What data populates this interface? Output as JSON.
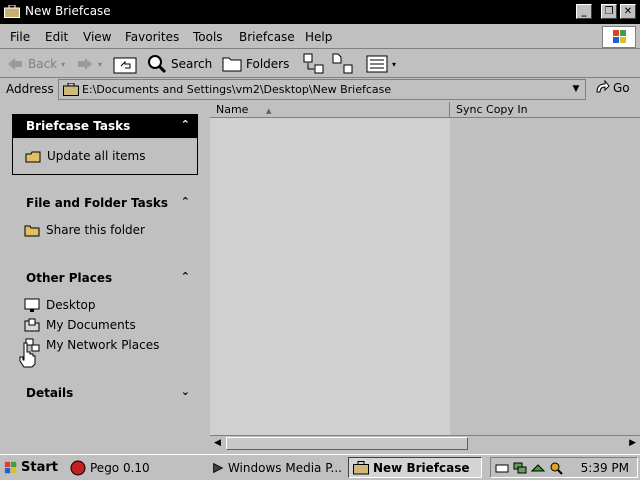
{
  "window": {
    "title": "New Briefcase",
    "controls": {
      "minimize": "_",
      "maximize": "❐",
      "close": "✕"
    }
  },
  "menubar": {
    "items": [
      "File",
      "Edit",
      "View",
      "Favorites",
      "Tools",
      "Briefcase",
      "Help"
    ]
  },
  "toolbar": {
    "back": "Back",
    "search": "Search",
    "folders": "Folders"
  },
  "address": {
    "label": "Address",
    "value": "E:\\Documents and Settings\\vm2\\Desktop\\New Briefcase",
    "go": "Go"
  },
  "taskpane": {
    "briefcase_tasks": {
      "title": "Briefcase Tasks",
      "items": [
        "Update all items"
      ]
    },
    "file_folder_tasks": {
      "title": "File and Folder Tasks",
      "items": [
        "Share this folder"
      ]
    },
    "other_places": {
      "title": "Other Places",
      "items": [
        "Desktop",
        "My Documents",
        "My Network Places"
      ]
    },
    "details": {
      "title": "Details"
    }
  },
  "filelist": {
    "columns": [
      "Name",
      "Sync Copy In"
    ]
  },
  "taskbar": {
    "start": "Start",
    "tasks": [
      "Pego 0.10",
      "Windows Media P...",
      "New Briefcase"
    ],
    "clock": "5:39 PM"
  }
}
